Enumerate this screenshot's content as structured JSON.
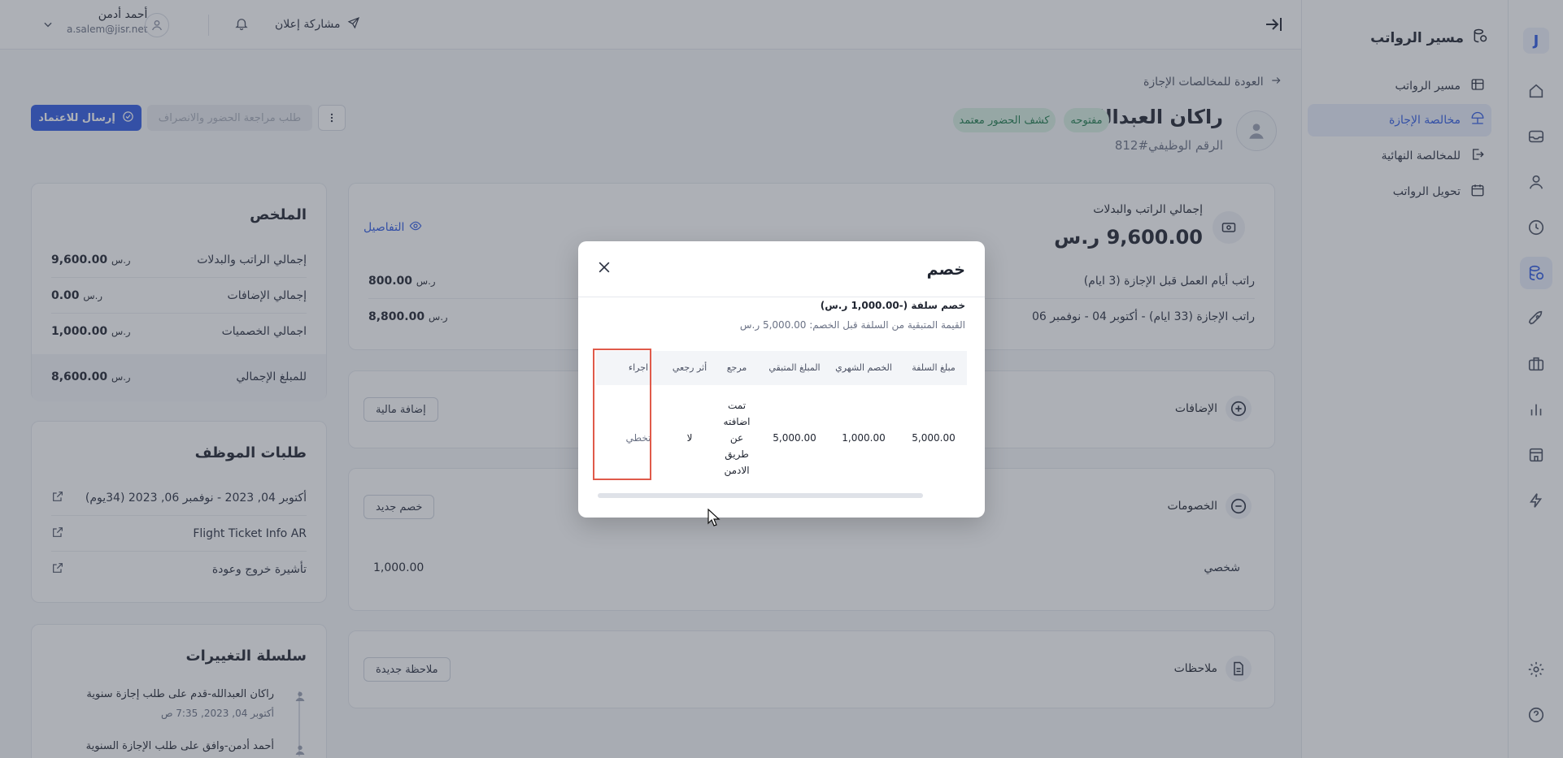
{
  "rail": {
    "logo": "J"
  },
  "sidebar": {
    "title": "مسير الرواتب",
    "items": [
      {
        "label": "مسير الرواتب"
      },
      {
        "label": "مخالصة الإجازة"
      },
      {
        "label": "للمخالصة النهائية"
      },
      {
        "label": "تحويل الرواتب"
      }
    ]
  },
  "topbar": {
    "user_name": "أحمد أدمن",
    "user_email": "a.salem@jisr.net",
    "share_label": "مشاركة إعلان"
  },
  "header": {
    "back_label": "العودة للمخالصات الإجازة",
    "employee_name": "راكان العبدالله",
    "employee_id": "الرقم الوظيفي#812",
    "badge_open": "مفتوحه",
    "badge_attendance": "كشف الحضور معتمد",
    "btn_submit": "إرسال للاعتماد",
    "btn_review": "طلب مراجعة الحضور والانصراف"
  },
  "salary_card": {
    "title": "إجمالي الراتب والبدلات",
    "total": "9,600.00 ر.س",
    "details": "التفاصيل",
    "rows": [
      {
        "label": "راتب أيام العمل قبل الإجازة (3 ايام)",
        "value": "800.00",
        "cur": "ر.س"
      },
      {
        "label": "راتب الإجازة (33 ايام) - أكتوبر 04 - نوفمبر 06",
        "value": "8,800.00",
        "cur": "ر.س"
      }
    ]
  },
  "additions": {
    "title": "الإضافات",
    "button": "إضافة مالية"
  },
  "deductions": {
    "title": "الخصومات",
    "button": "خصم جديد",
    "row_label": "شخصي",
    "row_value": "1,000.00"
  },
  "notes": {
    "title": "ملاحظات",
    "button": "ملاحظة جديدة"
  },
  "summary": {
    "title": "الملخص",
    "rows": [
      {
        "label": "إجمالي الراتب والبدلات",
        "value": "9,600.00",
        "cur": "ر.س"
      },
      {
        "label": "إجمالي الإضافات",
        "value": "0.00",
        "cur": "ر.س"
      },
      {
        "label": "اجمالي الخصميات",
        "value": "1,000.00",
        "cur": "ر.س"
      },
      {
        "label": "للمبلغ الإجمالي",
        "value": "8,600.00",
        "cur": "ر.س"
      }
    ]
  },
  "requests": {
    "title": "طلبات الموظف",
    "items": [
      {
        "label": "أكتوبر 04, 2023 - نوفمبر 06, 2023 (34يوم)"
      },
      {
        "label": "Flight Ticket Info AR"
      },
      {
        "label": "تأشيرة خروج وعودة"
      }
    ]
  },
  "changes": {
    "title": "سلسلة التغييرات",
    "items": [
      {
        "text": "راكان العبدالله-قدم على طلب إجازة سنوية",
        "time": "أكتوبر 04, 2023, 7:35 ص"
      },
      {
        "text": "أحمد أدمن-وافق على طلب الإجازة السنوية",
        "time": ""
      }
    ]
  },
  "modal": {
    "title": "خصم",
    "subtitle": "خصم سلفة (-1,000.00 ر.س)",
    "subtitle2": "القيمة المتبقية من السلفة قبل الخصم: 5,000.00 ر.س",
    "headers": [
      "مبلغ السلفة",
      "الخصم الشهري",
      "المبلغ المتبقي",
      "مرجع",
      "أثر رجعي",
      "اجراء"
    ],
    "row": {
      "amount": "5,000.00",
      "monthly": "1,000.00",
      "remaining": "5,000.00",
      "ref_lines": [
        "تمت",
        "اضافته",
        "عن",
        "طريق",
        "الادمن"
      ],
      "retro": "لا",
      "action": "تخطي"
    }
  },
  "colors": {
    "accent": "#2f5be3",
    "badge_bg": "#d7f0e2",
    "highlight": "#e05a4a"
  }
}
